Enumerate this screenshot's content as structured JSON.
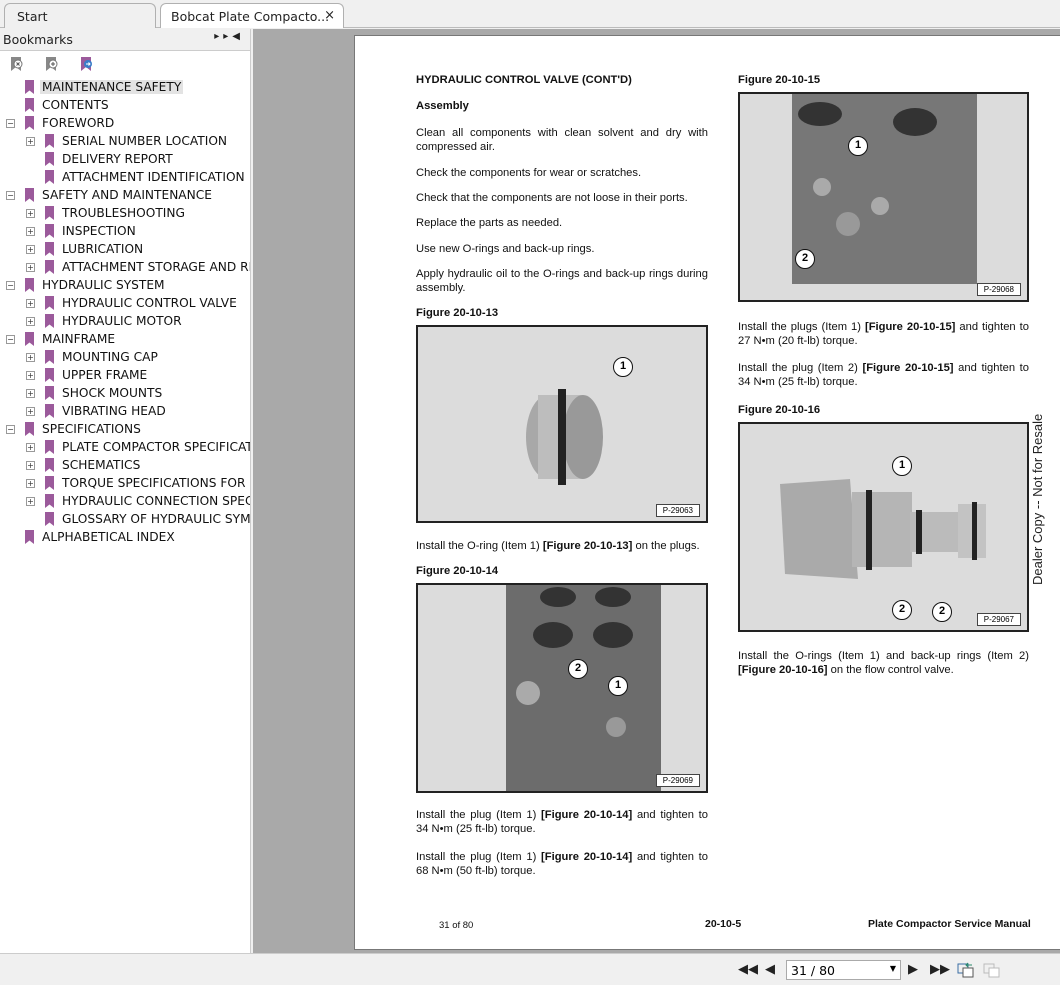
{
  "tabs": [
    {
      "label": "Start"
    },
    {
      "label": "Bobcat Plate Compacto...",
      "close": "×"
    }
  ],
  "bookmarks": {
    "title": "Bookmarks",
    "tools": [
      "delete-bookmark-icon",
      "add-bookmark-icon",
      "go-to-bookmark-icon"
    ],
    "items": [
      {
        "label": "MAINTENANCE SAFETY",
        "level": 0,
        "expander": "",
        "selected": true
      },
      {
        "label": "CONTENTS",
        "level": 0,
        "expander": ""
      },
      {
        "label": "FOREWORD",
        "level": 0,
        "expander": "−"
      },
      {
        "label": "SERIAL NUMBER LOCATION",
        "level": 1,
        "expander": "+"
      },
      {
        "label": "DELIVERY REPORT",
        "level": 1,
        "expander": ""
      },
      {
        "label": "ATTACHMENT IDENTIFICATION",
        "level": 1,
        "expander": ""
      },
      {
        "label": "SAFETY AND MAINTENANCE",
        "level": 0,
        "expander": "−"
      },
      {
        "label": "TROUBLESHOOTING",
        "level": 1,
        "expander": "+"
      },
      {
        "label": "INSPECTION",
        "level": 1,
        "expander": "+"
      },
      {
        "label": "LUBRICATION",
        "level": 1,
        "expander": "+"
      },
      {
        "label": "ATTACHMENT STORAGE AND RET",
        "level": 1,
        "expander": "+"
      },
      {
        "label": "HYDRAULIC SYSTEM",
        "level": 0,
        "expander": "−"
      },
      {
        "label": "HYDRAULIC CONTROL VALVE",
        "level": 1,
        "expander": "+"
      },
      {
        "label": "HYDRAULIC MOTOR",
        "level": 1,
        "expander": "+"
      },
      {
        "label": "MAINFRAME",
        "level": 0,
        "expander": "−"
      },
      {
        "label": "MOUNTING CAP",
        "level": 1,
        "expander": "+"
      },
      {
        "label": "UPPER FRAME",
        "level": 1,
        "expander": "+"
      },
      {
        "label": "SHOCK MOUNTS",
        "level": 1,
        "expander": "+"
      },
      {
        "label": "VIBRATING HEAD",
        "level": 1,
        "expander": "+"
      },
      {
        "label": "SPECIFICATIONS",
        "level": 0,
        "expander": "−"
      },
      {
        "label": "PLATE COMPACTOR SPECIFICATIO",
        "level": 1,
        "expander": "+"
      },
      {
        "label": "SCHEMATICS",
        "level": 1,
        "expander": "+"
      },
      {
        "label": "TORQUE SPECIFICATIONS FOR BO",
        "level": 1,
        "expander": "+"
      },
      {
        "label": "HYDRAULIC CONNECTION SPECIFI",
        "level": 1,
        "expander": "+"
      },
      {
        "label": "GLOSSARY OF HYDRAULIC SYMBO",
        "level": 1,
        "expander": ""
      },
      {
        "label": "ALPHABETICAL INDEX",
        "level": 0,
        "expander": ""
      }
    ]
  },
  "page": {
    "heading": "HYDRAULIC CONTROL VALVE (CONT'D)",
    "subheading": "Assembly",
    "paras": [
      "Clean all components with clean solvent and dry with compressed air.",
      "Check the components for wear or scratches.",
      "Check that the components are not loose in their ports.",
      "Replace the parts as needed.",
      "Use new O-rings and back-up rings.",
      "Apply hydraulic oil to the O-rings and back-up rings during assembly."
    ],
    "fig13": {
      "title": "Figure 20-10-13",
      "code": "P-29063",
      "callouts": [
        "1"
      ]
    },
    "fig13_text": {
      "a": "Install the O-ring (Item 1) ",
      "ref": "[Figure 20-10-13]",
      "b": " on the plugs."
    },
    "fig14": {
      "title": "Figure 20-10-14",
      "code": "P-29069",
      "callouts": [
        "2",
        "1"
      ]
    },
    "fig14_text1": {
      "a": "Install the plug (Item 1) ",
      "ref": "[Figure 20-10-14]",
      "b": " and tighten to 34 N•m (25 ft-lb) torque."
    },
    "fig14_text2": {
      "a": "Install the plug (Item 1) ",
      "ref": "[Figure 20-10-14]",
      "b": " and tighten to 68 N•m (50 ft-lb) torque."
    },
    "fig15": {
      "title": "Figure 20-10-15",
      "code": "P-29068",
      "callouts": [
        "1",
        "2"
      ]
    },
    "fig15_text1": {
      "a": "Install the plugs (Item 1) ",
      "ref": "[Figure 20-10-15]",
      "b": " and tighten to 27 N•m (20 ft-lb) torque."
    },
    "fig15_text2": {
      "a": "Install the plug (Item 2) ",
      "ref": "[Figure 20-10-15]",
      "b": " and tighten to 34 N•m (25 ft-lb) torque."
    },
    "fig16": {
      "title": "Figure 20-10-16",
      "code": "P-29067",
      "callouts": [
        "1",
        "2",
        "2"
      ]
    },
    "fig16_text": {
      "a": "Install the O-rings (Item 1) and back-up rings (Item 2) ",
      "ref": "[Figure 20-10-16]",
      "b": " on the flow control valve."
    },
    "footer": {
      "left": "31 of 80",
      "center": "20-10-5",
      "right": "Plate Compactor Service Manual"
    },
    "watermark": "Dealer Copy -- Not for Resale"
  },
  "nav": {
    "page_value": "31 / 80",
    "current_page": 31,
    "total_pages": 80
  }
}
